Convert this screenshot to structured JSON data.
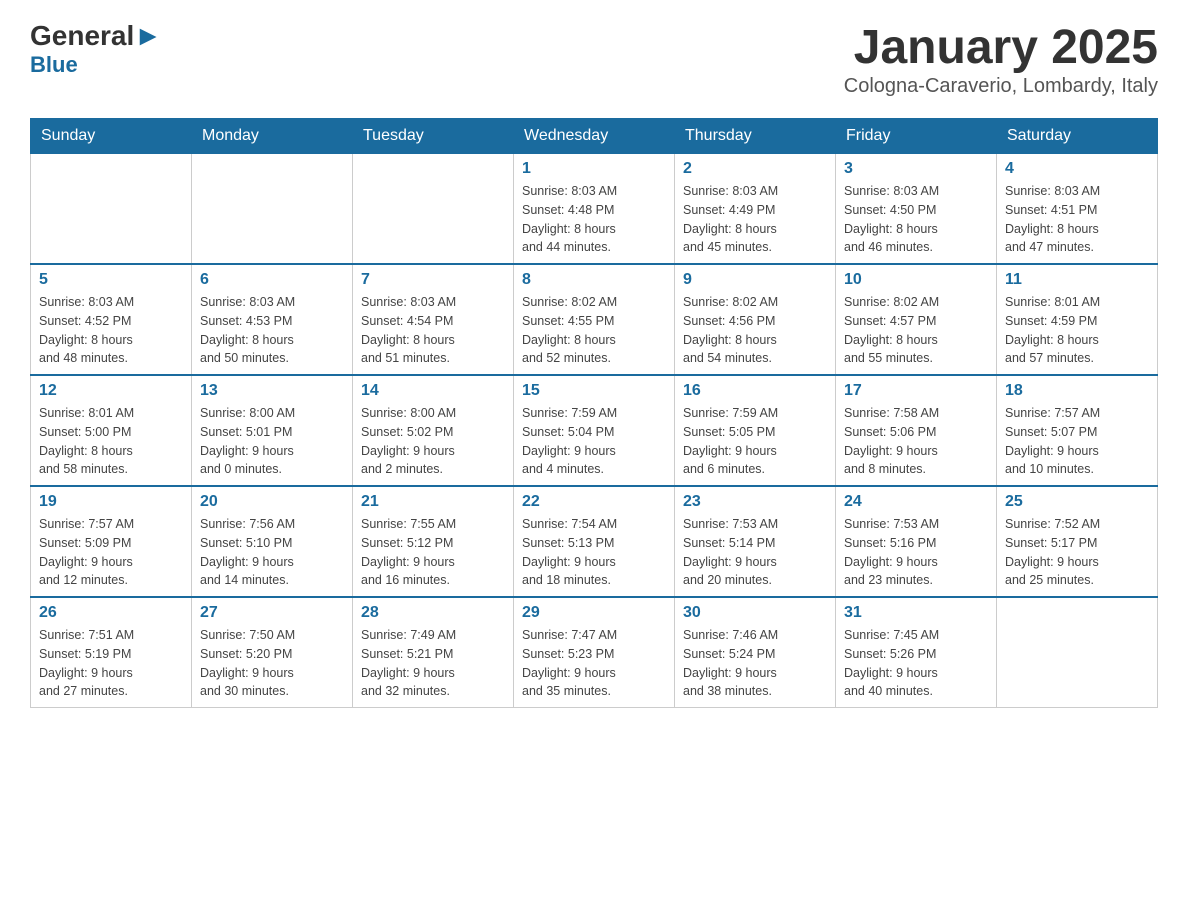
{
  "header": {
    "logo_general": "General",
    "logo_blue": "Blue",
    "month_title": "January 2025",
    "location": "Cologna-Caraverio, Lombardy, Italy"
  },
  "weekdays": [
    "Sunday",
    "Monday",
    "Tuesday",
    "Wednesday",
    "Thursday",
    "Friday",
    "Saturday"
  ],
  "weeks": [
    [
      {
        "day": "",
        "info": ""
      },
      {
        "day": "",
        "info": ""
      },
      {
        "day": "",
        "info": ""
      },
      {
        "day": "1",
        "info": "Sunrise: 8:03 AM\nSunset: 4:48 PM\nDaylight: 8 hours\nand 44 minutes."
      },
      {
        "day": "2",
        "info": "Sunrise: 8:03 AM\nSunset: 4:49 PM\nDaylight: 8 hours\nand 45 minutes."
      },
      {
        "day": "3",
        "info": "Sunrise: 8:03 AM\nSunset: 4:50 PM\nDaylight: 8 hours\nand 46 minutes."
      },
      {
        "day": "4",
        "info": "Sunrise: 8:03 AM\nSunset: 4:51 PM\nDaylight: 8 hours\nand 47 minutes."
      }
    ],
    [
      {
        "day": "5",
        "info": "Sunrise: 8:03 AM\nSunset: 4:52 PM\nDaylight: 8 hours\nand 48 minutes."
      },
      {
        "day": "6",
        "info": "Sunrise: 8:03 AM\nSunset: 4:53 PM\nDaylight: 8 hours\nand 50 minutes."
      },
      {
        "day": "7",
        "info": "Sunrise: 8:03 AM\nSunset: 4:54 PM\nDaylight: 8 hours\nand 51 minutes."
      },
      {
        "day": "8",
        "info": "Sunrise: 8:02 AM\nSunset: 4:55 PM\nDaylight: 8 hours\nand 52 minutes."
      },
      {
        "day": "9",
        "info": "Sunrise: 8:02 AM\nSunset: 4:56 PM\nDaylight: 8 hours\nand 54 minutes."
      },
      {
        "day": "10",
        "info": "Sunrise: 8:02 AM\nSunset: 4:57 PM\nDaylight: 8 hours\nand 55 minutes."
      },
      {
        "day": "11",
        "info": "Sunrise: 8:01 AM\nSunset: 4:59 PM\nDaylight: 8 hours\nand 57 minutes."
      }
    ],
    [
      {
        "day": "12",
        "info": "Sunrise: 8:01 AM\nSunset: 5:00 PM\nDaylight: 8 hours\nand 58 minutes."
      },
      {
        "day": "13",
        "info": "Sunrise: 8:00 AM\nSunset: 5:01 PM\nDaylight: 9 hours\nand 0 minutes."
      },
      {
        "day": "14",
        "info": "Sunrise: 8:00 AM\nSunset: 5:02 PM\nDaylight: 9 hours\nand 2 minutes."
      },
      {
        "day": "15",
        "info": "Sunrise: 7:59 AM\nSunset: 5:04 PM\nDaylight: 9 hours\nand 4 minutes."
      },
      {
        "day": "16",
        "info": "Sunrise: 7:59 AM\nSunset: 5:05 PM\nDaylight: 9 hours\nand 6 minutes."
      },
      {
        "day": "17",
        "info": "Sunrise: 7:58 AM\nSunset: 5:06 PM\nDaylight: 9 hours\nand 8 minutes."
      },
      {
        "day": "18",
        "info": "Sunrise: 7:57 AM\nSunset: 5:07 PM\nDaylight: 9 hours\nand 10 minutes."
      }
    ],
    [
      {
        "day": "19",
        "info": "Sunrise: 7:57 AM\nSunset: 5:09 PM\nDaylight: 9 hours\nand 12 minutes."
      },
      {
        "day": "20",
        "info": "Sunrise: 7:56 AM\nSunset: 5:10 PM\nDaylight: 9 hours\nand 14 minutes."
      },
      {
        "day": "21",
        "info": "Sunrise: 7:55 AM\nSunset: 5:12 PM\nDaylight: 9 hours\nand 16 minutes."
      },
      {
        "day": "22",
        "info": "Sunrise: 7:54 AM\nSunset: 5:13 PM\nDaylight: 9 hours\nand 18 minutes."
      },
      {
        "day": "23",
        "info": "Sunrise: 7:53 AM\nSunset: 5:14 PM\nDaylight: 9 hours\nand 20 minutes."
      },
      {
        "day": "24",
        "info": "Sunrise: 7:53 AM\nSunset: 5:16 PM\nDaylight: 9 hours\nand 23 minutes."
      },
      {
        "day": "25",
        "info": "Sunrise: 7:52 AM\nSunset: 5:17 PM\nDaylight: 9 hours\nand 25 minutes."
      }
    ],
    [
      {
        "day": "26",
        "info": "Sunrise: 7:51 AM\nSunset: 5:19 PM\nDaylight: 9 hours\nand 27 minutes."
      },
      {
        "day": "27",
        "info": "Sunrise: 7:50 AM\nSunset: 5:20 PM\nDaylight: 9 hours\nand 30 minutes."
      },
      {
        "day": "28",
        "info": "Sunrise: 7:49 AM\nSunset: 5:21 PM\nDaylight: 9 hours\nand 32 minutes."
      },
      {
        "day": "29",
        "info": "Sunrise: 7:47 AM\nSunset: 5:23 PM\nDaylight: 9 hours\nand 35 minutes."
      },
      {
        "day": "30",
        "info": "Sunrise: 7:46 AM\nSunset: 5:24 PM\nDaylight: 9 hours\nand 38 minutes."
      },
      {
        "day": "31",
        "info": "Sunrise: 7:45 AM\nSunset: 5:26 PM\nDaylight: 9 hours\nand 40 minutes."
      },
      {
        "day": "",
        "info": ""
      }
    ]
  ]
}
